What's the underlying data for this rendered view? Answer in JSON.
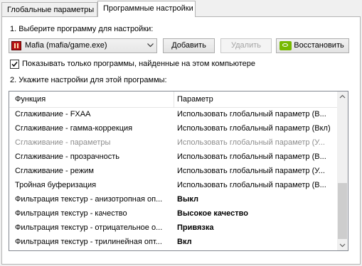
{
  "tabs": [
    "Глобальные параметры",
    "Программные настройки"
  ],
  "step1_label": "1. Выберите программу для настройки:",
  "program": {
    "selected": "Mafia (mafia/game.exe)"
  },
  "buttons": {
    "add": "Добавить",
    "remove": "Удалить",
    "restore": "Восстановить"
  },
  "show_only_label": "Показывать только программы, найденные на этом компьютере",
  "show_only_checked": true,
  "step2_label": "2. Укажите настройки для этой программы:",
  "table": {
    "headers": [
      "Функция",
      "Параметр"
    ],
    "rows": [
      {
        "feature": "Сглаживание - FXAA",
        "value": "Использовать глобальный параметр (В..."
      },
      {
        "feature": "Сглаживание - гамма-коррекция",
        "value": "Использовать глобальный параметр (Вкл)"
      },
      {
        "feature": "Сглаживание - параметры",
        "value": "Использовать глобальный параметр (У...",
        "disabled": true
      },
      {
        "feature": "Сглаживание - прозрачность",
        "value": "Использовать глобальный параметр (В..."
      },
      {
        "feature": "Сглаживание - режим",
        "value": "Использовать глобальный параметр (У..."
      },
      {
        "feature": "Тройная буферизация",
        "value": "Использовать глобальный параметр (В..."
      },
      {
        "feature": "Фильтрация текстур - анизотропная оп...",
        "value": "Выкл",
        "bold": true
      },
      {
        "feature": "Фильтрация текстур - качество",
        "value": "Высокое качество",
        "bold": true
      },
      {
        "feature": "Фильтрация текстур - отрицательное о...",
        "value": "Привязка",
        "bold": true
      },
      {
        "feature": "Фильтрация текстур - трилинейная опт...",
        "value": "Вкл",
        "bold": true
      }
    ]
  },
  "icons": {
    "app": "mafia-game-icon",
    "restore": "nvidia-logo-icon",
    "combo_arrow": "chevron-down-icon",
    "checkbox": "checkmark-icon",
    "scroll_up": "arrow-up-icon",
    "scroll_down": "arrow-down-icon"
  },
  "colors": {
    "nvidia_green": "#76b900",
    "disabled_text": "#8d8d8d"
  }
}
